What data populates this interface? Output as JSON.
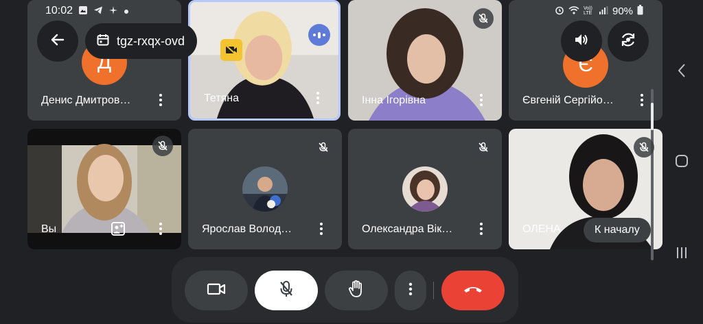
{
  "status_bar": {
    "time": "10:02",
    "left_icons": [
      "image-icon",
      "telegram-icon",
      "sparkle-icon",
      "dot-icon"
    ],
    "right_icons": [
      "alarm-icon",
      "wifi-icon",
      "volte-icon",
      "signal-icon",
      "battery-icon"
    ],
    "network_label": "Vo)) LTE",
    "battery": "90%"
  },
  "header": {
    "meeting_code": "tgz-rxqx-ovd",
    "icons": {
      "back": "arrow-back-icon",
      "calendar": "calendar-icon",
      "audio": "speaker-icon",
      "switch_camera": "switch-camera-icon"
    }
  },
  "participants": [
    {
      "name": "Денис Дмитров…",
      "avatar_letter": "Д",
      "muted": false
    },
    {
      "name": "Тетяна",
      "speaking": true,
      "active": true,
      "badge_icon": "camera-off-icon"
    },
    {
      "name": "Інна Ігорівна",
      "muted": true
    },
    {
      "name": "Євгеній Сергійо…",
      "avatar_letter": "Є",
      "muted": false
    },
    {
      "name": "Вы",
      "muted": true,
      "self": true,
      "effects_icon": "visual-effects-icon"
    },
    {
      "name": "Ярослав Волод…",
      "muted": true
    },
    {
      "name": "Олександра Вік…",
      "muted": true
    },
    {
      "name": "ОЛЕНА",
      "muted": true
    }
  ],
  "back_to_top_label": "К началу",
  "controls": {
    "camera_icon": "video-camera-icon",
    "mic_icon": "mic-off-icon",
    "hand_icon": "raise-hand-icon",
    "more_icon": "more-vert-icon",
    "end_call_icon": "call-end-icon",
    "end_call_color": "#ea4335",
    "mic_color": "#ffffff"
  },
  "system_nav": {
    "back_icon": "chevron-left-icon",
    "home_icon": "home-square-icon",
    "recents_icon": "recents-icon"
  },
  "colors": {
    "background": "#202124",
    "tile": "#3c4043",
    "avatar_orange": "#f0712c",
    "speaking_badge": "#5f7bd8"
  }
}
